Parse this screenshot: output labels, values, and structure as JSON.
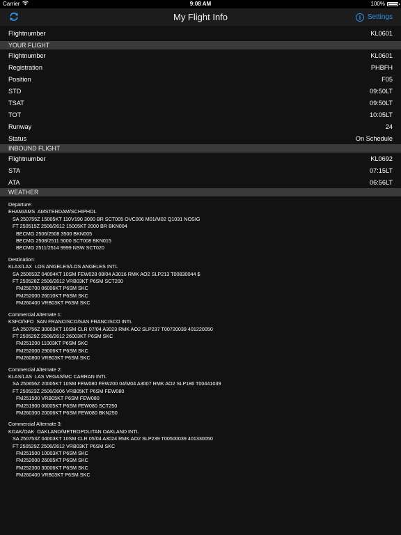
{
  "statusbar": {
    "carrier": "Carrier",
    "time": "9:08 AM",
    "battery": "100%",
    "battery_level": 1.0
  },
  "navbar": {
    "title": "My Flight Info",
    "settings_label": "Settings",
    "accent_color": "#2f8fe8"
  },
  "top": {
    "label": "Flightnumber",
    "value": "KL0601"
  },
  "your_flight": {
    "header": "YOUR FLIGHT",
    "rows": [
      {
        "label": "Flightnumber",
        "value": "KL0601"
      },
      {
        "label": "Registration",
        "value": "PHBFH"
      },
      {
        "label": "Position",
        "value": "F05"
      },
      {
        "label": "STD",
        "value": "09:50LT"
      },
      {
        "label": "TSAT",
        "value": "09:50LT"
      },
      {
        "label": "TOT",
        "value": "10:05LT"
      },
      {
        "label": "Runway",
        "value": "24"
      },
      {
        "label": "Status",
        "value": "On Schedule"
      }
    ]
  },
  "inbound_flight": {
    "header": "INBOUND FLIGHT",
    "rows": [
      {
        "label": "Flightnumber",
        "value": "KL0692"
      },
      {
        "label": "STA",
        "value": "07:15LT"
      },
      {
        "label": "ATA",
        "value": "06:56LT"
      }
    ]
  },
  "weather": {
    "header": "WEATHER",
    "blocks": [
      {
        "title": "Departure:",
        "station": "EHAM/AMS  AMSTERDAM/SCHIPHOL",
        "sa": "SA 250755Z 15005KT 110V190 3000 BR SCT005 OVC006 M01/M02 Q1031 NOSIG",
        "ft": "FT 250515Z 2506/2612 15005KT 2000 BR BKN004",
        "lines": [
          "BECMG 2506/2508 3500 BKN005",
          "BECMG 2508/2511 5000 SCT008 BKN015",
          "BECMG 2511/2514 9999 NSW SCT020"
        ]
      },
      {
        "title": "Destination:",
        "station": "KLAX/LAX  LOS ANGELES/LOS ANGELES INTL",
        "sa": "SA 250653Z 04004KT 10SM FEW028 08/04 A3016 RMK AO2 SLP213 T00830044 $",
        "ft": "FT 250528Z 2506/2612 VRB03KT P6SM SCT200",
        "lines": [
          "FM250700 06006KT P6SM SKC",
          "FM252000 26010KT P6SM SKC",
          "FM260400 VRB03KT P6SM SKC"
        ]
      },
      {
        "title": "Commercial Alternate 1:",
        "station": "KSFO/SFO  SAN FRANCISCO/SAN FRANCISCO INTL",
        "sa": "SA 250756Z 30003KT 10SM CLR 07/04 A3023 RMK AO2 SLP237 T00720039 401220050",
        "ft": "FT 250529Z 2506/2612 26003KT P6SM SKC",
        "lines": [
          "FM251200 11003KT P6SM SKC",
          "FM252000 29006KT P6SM SKC",
          "FM260800 VRB03KT P6SM SKC"
        ]
      },
      {
        "title": "Commercial Alternate 2:",
        "station": "KLAS/LAS  LAS VEGAS/MC CARRAN INTL",
        "sa": "SA 250656Z 20005KT 10SM FEW080 FEW200 04/M04 A3007 RMK AO2 SLP186 T00441039",
        "ft": "FT 250523Z 2506/2606 VRB05KT P6SM FEW080",
        "lines": [
          "FM251500 VRB05KT P6SM FEW080",
          "FM251900 06005KT P6SM FEW080 SCT250",
          "FM260300 20006KT P6SM FEW080 BKN250"
        ]
      },
      {
        "title": "Commercial Alternate 3:",
        "station": "KOAK/OAK  OAKLAND/METROPOLITAN OAKLAND INTL",
        "sa": "SA 250753Z 04003KT 10SM CLR 05/04 A3024 RMK AO2 SLP239 T00500039 401330050",
        "ft": "FT 250529Z 2506/2612 VRB03KT P6SM SKC",
        "lines": [
          "FM251500 10003KT P6SM SKC",
          "FM252000 26005KT P6SM SKC",
          "FM252300 30006KT P6SM SKC",
          "FM260400 VRB03KT P6SM SKC"
        ]
      }
    ]
  }
}
